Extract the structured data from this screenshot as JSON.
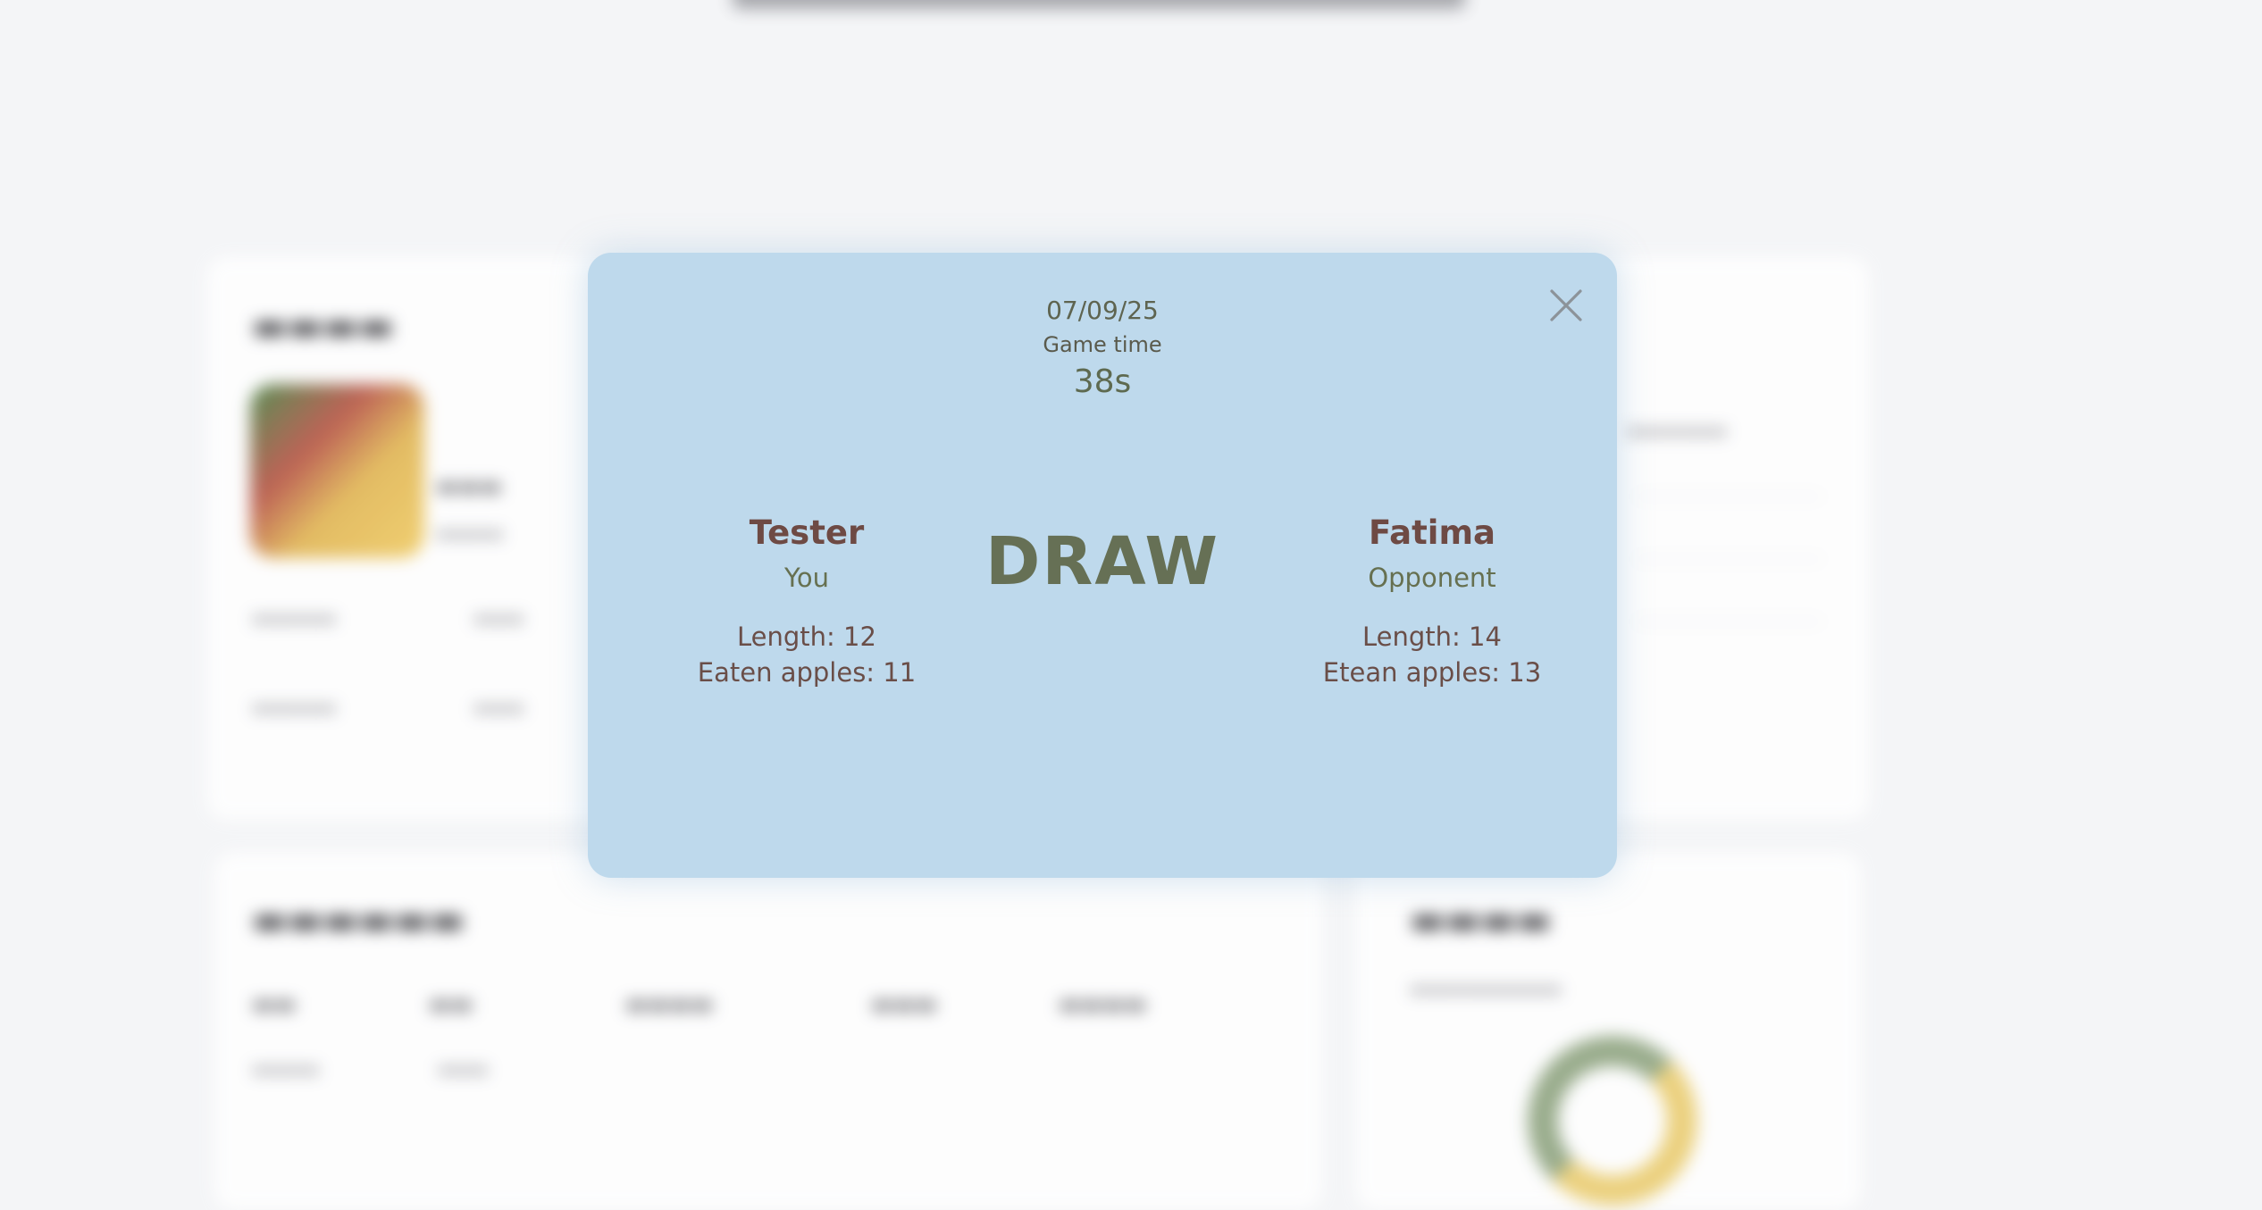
{
  "modal": {
    "date": "07/09/25",
    "game_time_label": "Game time",
    "game_time_value": "38s",
    "result": "DRAW",
    "player_left": {
      "name": "Tester",
      "role": "You",
      "length": "Length: 12",
      "apples": "Eaten apples: 11"
    },
    "player_right": {
      "name": "Fatima",
      "role": "Opponent",
      "length": "Length: 14",
      "apples": "Etean apples: 13"
    },
    "close_icon": "close-icon"
  },
  "colors": {
    "modal_background": "#bed9ec",
    "player_name": "#6e4a44",
    "result_text": "#667055",
    "page_background": "#f4f5f7"
  }
}
